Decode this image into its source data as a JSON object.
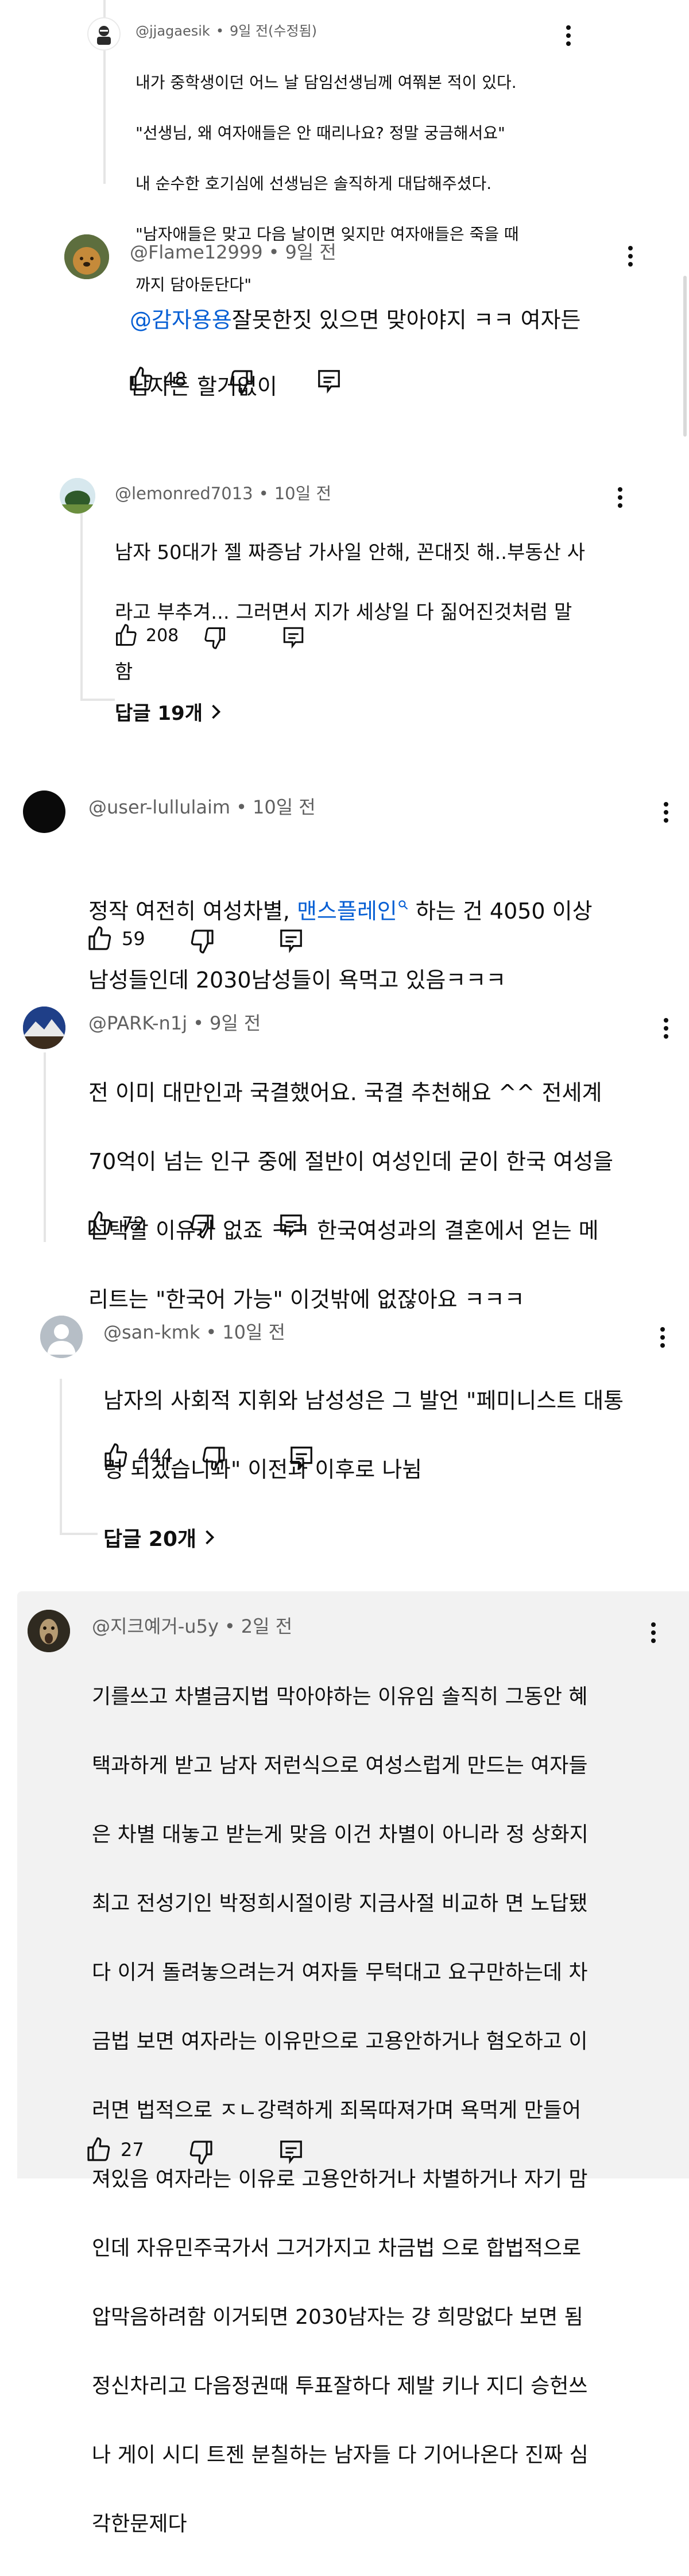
{
  "comments": [
    {
      "author": "@jjagaesik",
      "time": "9일 전(수정됨)",
      "lines": [
        "내가 중학생이던 어느 날 담임선생님께 여쭤본 적이 있다.",
        "\"선생님, 왜 여자애들은 안 때리나요? 정말 궁금해서요\"",
        "내 순수한 호기심에 선생님은 솔직하게 대답해주셨다.",
        "\"남자애들은 맞고 다음 날이면 잊지만 여자애들은 죽을 때",
        "까지 담아둔단다\""
      ]
    },
    {
      "author": "@Flame12999",
      "time": "9일 전",
      "mention": "@감자용용",
      "text_first": "잘못한짓 있으면 맞아야지 ㅋㅋ 여자든",
      "text_second": "남자든 할거없이",
      "likes": "48"
    },
    {
      "author": "@lemonred7013",
      "time": "10일 전",
      "lines": [
        "남자 50대가 젤 짜증남 가사일 안해, 꼰대짓 해..부동산 사",
        "라고 부추겨... 그러면서 지가 세상일 다 짊어진것처럼 말",
        "함"
      ],
      "likes": "208",
      "replies": "답글 19개"
    },
    {
      "author": "@user-lullulaim",
      "time": "10일 전",
      "text_before": "정작 여전히 여성차별, ",
      "link": "맨스플레인",
      "text_after": " 하는 건 4050 이상",
      "line2": "남성들인데 2030남성들이 욕먹고 있음ㅋㅋㅋ",
      "likes": "59"
    },
    {
      "author": "@PARK-n1j",
      "time": "9일 전",
      "lines": [
        "전 이미 대만인과 국결했어요.  국결 추천해요 ^^ 전세계",
        "70억이 넘는 인구 중에 절반이 여성인데 굳이 한국 여성을",
        "선택할 이유가 없죠 ㅋㅋ 한국여성과의 결혼에서 얻는 메",
        "리트는 \"한국어 가능\" 이것밖에 없잖아요 ㅋㅋㅋ"
      ],
      "likes": "72"
    },
    {
      "author": "@san-kmk",
      "time": "10일 전",
      "lines": [
        "남자의 사회적 지휘와 남성성은 그 발언 \"페미니스트 대통",
        "령 되겠습니꽈\" 이전과 이후로 나뉨"
      ],
      "likes": "444",
      "replies": "답글 20개"
    },
    {
      "author": "@지크예거-u5y",
      "time": "2일 전",
      "lines": [
        "기를쓰고 차별금지법 막아야하는 이유임 솔직히 그동안 혜",
        "택과하게 받고 남자 저런식으로 여성스럽게 만드는 여자들",
        "은 차별 대놓고 받는게 맞음 이건 차별이 아니라 정 상화지",
        "최고 전성기인 박정희시절이랑 지금사절 비교하 면 노답됐",
        "다 이거 돌려놓으려는거 여자들 무턱대고 요구만하는데 차",
        "금법 보면 여자라는 이유만으로 고용안하거나 혐오하고 이",
        "러면 법적으로 ㅈㄴ강력하게 죄목따져가며 욕먹게 만들어",
        "져있음 여자라는 이유로 고용안하거나 차별하거나 자기 맘",
        "인데 자유민주국가서 그거가지고 차금법 으로 합법적으로",
        "압막음하려함 이거되면 2030남자는 걍 희망없다 보면 됨",
        "정신차리고 다음정권때 투표잘하다 제발 키나 지디 승헌쓰",
        "나 게이 시디 트젠 분칠하는 남자들 다 기어나온다 진짜 심",
        "각한문제다"
      ],
      "likes": "27"
    }
  ],
  "colors": {
    "link": "#065fd4",
    "meta": "#606060",
    "text": "#0f0f0f"
  },
  "icons": [
    "like-icon",
    "dislike-icon",
    "reply-icon",
    "more-vert-icon",
    "chevron-right-icon",
    "search-icon"
  ]
}
